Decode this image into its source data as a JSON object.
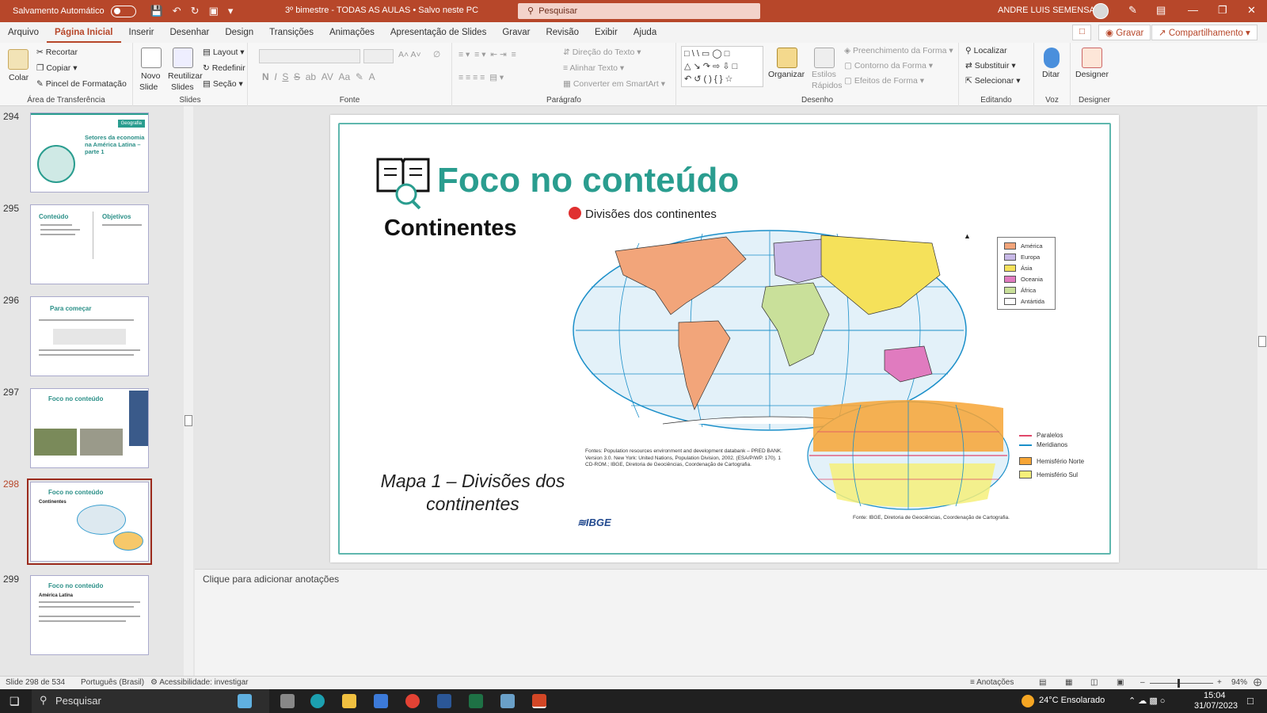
{
  "titlebar": {
    "autosave": "Salvamento Automático",
    "document_title": "3º bimestre - TODAS AS AULAS  •  Salvo neste PC",
    "search_placeholder": "Pesquisar",
    "user": "ANDRE LUIS SEMENSATO"
  },
  "menu": {
    "tabs": [
      "Arquivo",
      "Página Inicial",
      "Inserir",
      "Desenhar",
      "Design",
      "Transições",
      "Animações",
      "Apresentação de Slides",
      "Gravar",
      "Revisão",
      "Exibir",
      "Ajuda"
    ],
    "active": "Página Inicial",
    "record_label": "Gravar",
    "share_label": "Compartilhamento"
  },
  "ribbon": {
    "clipboard": {
      "paste": "Colar",
      "cut": "Recortar",
      "copy": "Copiar",
      "format_painter": "Pincel de Formatação",
      "label": "Área de Transferência"
    },
    "slides": {
      "new": "Novo",
      "new2": "Slide",
      "reuse": "Reutilizar",
      "reuse2": "Slides",
      "layout": "Layout",
      "reset": "Redefinir",
      "section": "Seção",
      "label": "Slides"
    },
    "font": {
      "label": "Fonte"
    },
    "paragraph": {
      "text_dir": "Direção do Texto",
      "align_text": "Alinhar Texto",
      "smartart": "Converter em SmartArt",
      "label": "Parágrafo"
    },
    "drawing": {
      "arrange": "Organizar",
      "quick_styles": "Estilos",
      "quick_styles2": "Rápidos",
      "fill": "Preenchimento da Forma",
      "outline": "Contorno da Forma",
      "effects": "Efeitos de Forma",
      "label": "Desenho"
    },
    "editing": {
      "find": "Localizar",
      "replace": "Substituir",
      "select": "Selecionar",
      "label": "Editando"
    },
    "voice": {
      "dictate": "Ditar",
      "label": "Voz"
    },
    "designer": {
      "designer": "Designer",
      "label": "Designer"
    }
  },
  "thumbnails": [
    {
      "num": "294",
      "title": "Setores da economia na América Latina – parte 1",
      "badge": "Geografia"
    },
    {
      "num": "295",
      "title": "Conteúdo",
      "title2": "Objetivos"
    },
    {
      "num": "296",
      "title": "Para começar"
    },
    {
      "num": "297",
      "title": "Foco no conteúdo"
    },
    {
      "num": "298",
      "title": "Foco no conteúdo",
      "sub": "Continentes"
    },
    {
      "num": "299",
      "title": "Foco no conteúdo",
      "sub": "América Latina"
    }
  ],
  "slide": {
    "title": "Foco no conteúdo",
    "subtitle": "Continentes",
    "map_title": "Divisões dos continentes",
    "caption": "Mapa 1 – Divisões dos continentes",
    "logo": "IBGE",
    "sources": "Fontes: Population resources environment and development databank – PRED BANK. Version 3.0. New York: United Nations, Population Division, 2002. (ESA/P/WP. 170). 1 CD-ROM.; IBGE, Diretoria de Geociências, Coordenação de Cartografia.",
    "sources2": "Fonte: IBGE, Diretoria de Geociências, Coordenação de Cartografia.",
    "legend": [
      "América",
      "Europa",
      "Ásia",
      "Oceania",
      "África",
      "Antártida"
    ],
    "legend_colors": [
      "#f2a57a",
      "#c7b8e6",
      "#f5e15a",
      "#e07bbf",
      "#c9e09a",
      "#ffffff"
    ],
    "legend2": [
      "Paralelos",
      "Meridianos",
      "Hemisfério Norte",
      "Hemisfério Sul"
    ]
  },
  "notes_placeholder": "Clique para adicionar anotações",
  "status": {
    "slide": "Slide 298 de 534",
    "language": "Português (Brasil)",
    "accessibility": "Acessibilidade: investigar",
    "notes": "Anotações",
    "zoom": "94%"
  },
  "taskbar": {
    "search": "Pesquisar",
    "weather": "24°C  Ensolarado",
    "time": "15:04",
    "date": "31/07/2023"
  }
}
